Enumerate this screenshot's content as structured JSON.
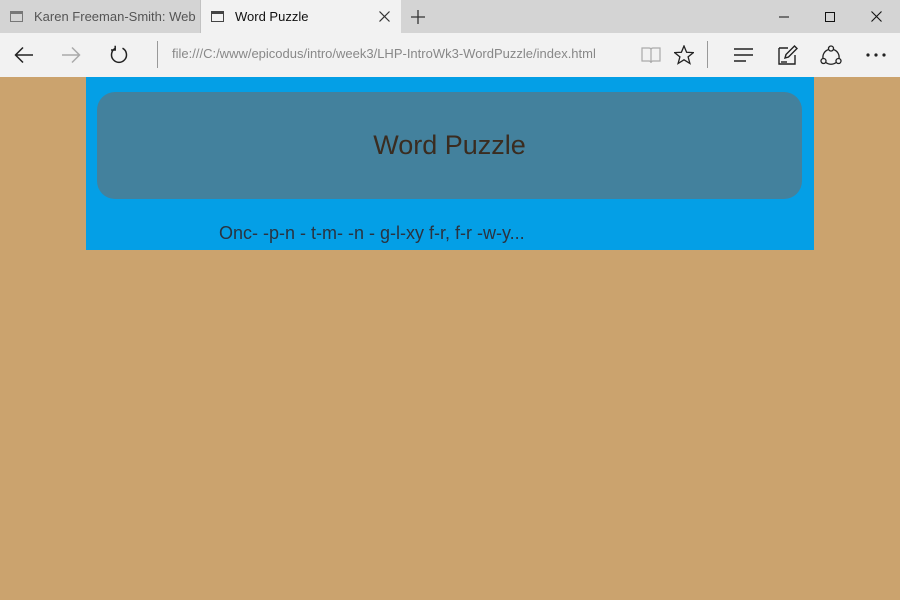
{
  "browser": {
    "tabs": [
      {
        "title": "Karen Freeman-Smith: Web",
        "active": false
      },
      {
        "title": "Word Puzzle",
        "active": true
      }
    ],
    "address": "file:///C:/www/epicodus/intro/week3/LHP-IntroWk3-WordPuzzle/index.html",
    "icons": {
      "tab": "tab-page-icon",
      "tab_close": "close-icon",
      "new_tab": "plus-icon",
      "minimize": "minimize-icon",
      "maximize": "maximize-icon",
      "close_window": "close-icon",
      "back": "back-arrow-icon",
      "forward": "forward-arrow-icon",
      "refresh": "refresh-icon",
      "reading_view": "book-icon",
      "favorite": "star-icon",
      "hub": "hub-icon",
      "web_note": "pen-note-icon",
      "share": "share-icon",
      "more": "more-icon"
    }
  },
  "page": {
    "title": "Word Puzzle",
    "puzzle_text": "Onc- -p-n - t-m- -n - g-l-xy f-r, f-r -w-y..."
  },
  "colors": {
    "page_background": "#cba36e",
    "container_background": "#049fe6",
    "jumbotron_background": "#43819d",
    "title_color": "#3a2c20"
  }
}
